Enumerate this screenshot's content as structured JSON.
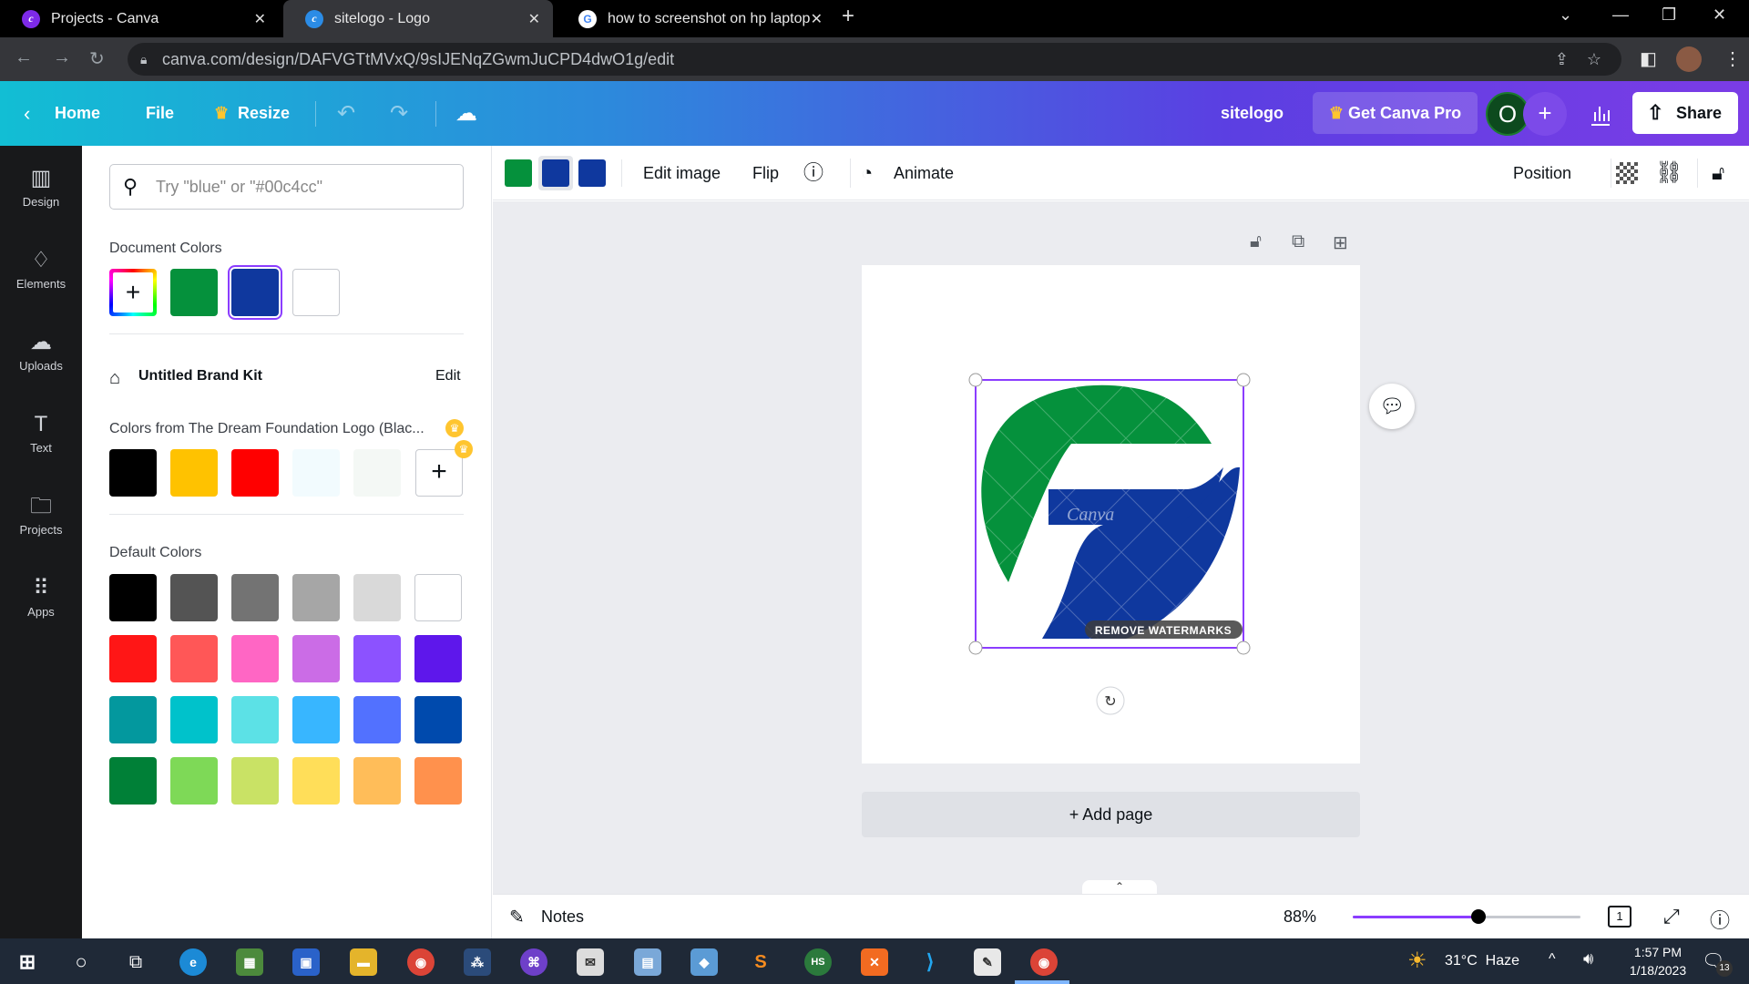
{
  "browser": {
    "tabs": [
      {
        "title": "Projects - Canva"
      },
      {
        "title": "sitelogo - Logo"
      },
      {
        "title": "how to screenshot on hp laptop"
      }
    ],
    "url": "canva.com/design/DAFVGTtMVxQ/9sIJENqZGwmJuCPD4dwO1g/edit"
  },
  "header": {
    "home": "Home",
    "file": "File",
    "resize": "Resize",
    "design_title": "sitelogo",
    "get_pro": "Get Canva Pro",
    "avatar_letter": "O",
    "share": "Share"
  },
  "rail": [
    {
      "label": "Design",
      "icon": "design-icon"
    },
    {
      "label": "Elements",
      "icon": "elements-icon"
    },
    {
      "label": "Uploads",
      "icon": "uploads-icon"
    },
    {
      "label": "Text",
      "icon": "text-icon"
    },
    {
      "label": "Projects",
      "icon": "projects-icon"
    },
    {
      "label": "Apps",
      "icon": "apps-icon"
    }
  ],
  "panel": {
    "search_placeholder": "Try \"blue\" or \"#00c4cc\"",
    "document_colors_title": "Document Colors",
    "document_colors": [
      "#05913c",
      "#0f389e",
      "#ffffff"
    ],
    "brand_kit": "Untitled Brand Kit",
    "brand_edit": "Edit",
    "logo_colors_title": "Colors from The Dream Foundation Logo (Blac...",
    "logo_colors": [
      "#000000",
      "#ffc200",
      "#ff0000",
      "#f2fbfe",
      "#f4f8f5"
    ],
    "default_colors_title": "Default Colors",
    "default_colors": [
      [
        "#000000",
        "#545454",
        "#737373",
        "#a6a6a6",
        "#d9d9d9",
        "#ffffff"
      ],
      [
        "#ff1616",
        "#ff5757",
        "#ff66c4",
        "#cb6ce6",
        "#8c52ff",
        "#5e17eb"
      ],
      [
        "#03989e",
        "#00c2cb",
        "#5ce1e6",
        "#38b6ff",
        "#5271ff",
        "#004aad"
      ],
      [
        "#008037",
        "#7ed957",
        "#c9e265",
        "#ffde59",
        "#ffbd59",
        "#ff914d"
      ]
    ]
  },
  "toolbar": {
    "swatches": [
      "#05913c",
      "#0f389e",
      "#0f389e"
    ],
    "edit_image": "Edit image",
    "flip": "Flip",
    "animate": "Animate",
    "position": "Position"
  },
  "canvas": {
    "watermark_text": "Canva",
    "remove_watermarks": "REMOVE WATERMARKS",
    "add_page": "+ Add page"
  },
  "bottom": {
    "notes": "Notes",
    "zoom": "88%",
    "zoom_fraction": 0.55,
    "page_count": "1"
  },
  "taskbar": {
    "weather": "31°C  Haze",
    "time": "1:57 PM",
    "date": "1/18/2023",
    "notif_count": "13"
  },
  "colors": {
    "logo_green": "#05913c",
    "logo_blue": "#0f389e",
    "selection": "#8b3dff"
  }
}
